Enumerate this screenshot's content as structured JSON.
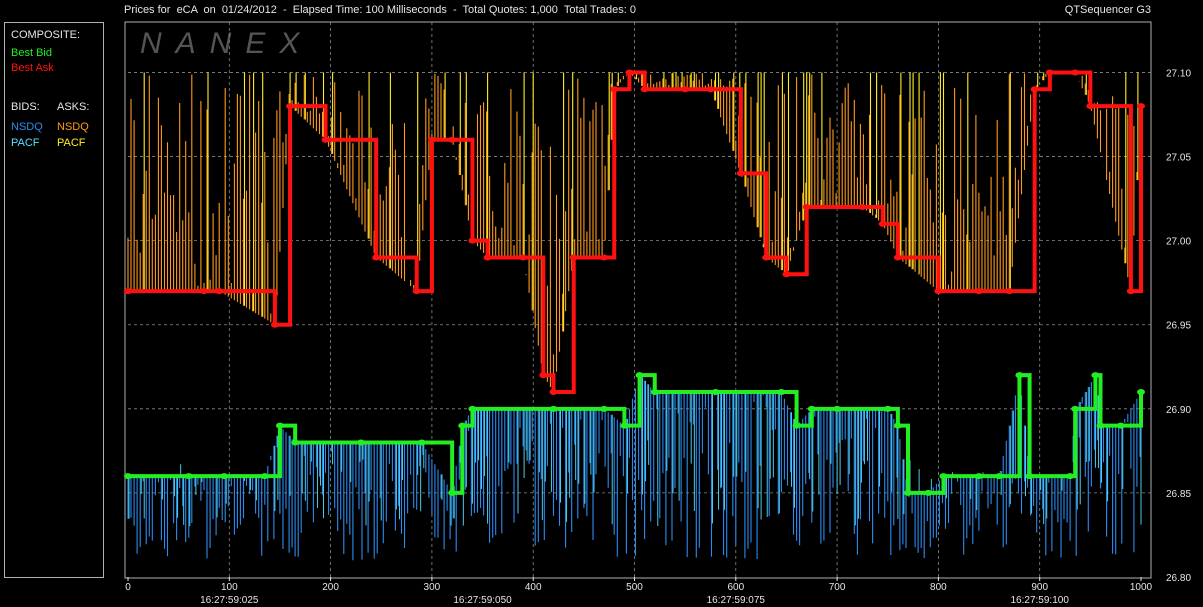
{
  "header": {
    "title": "Prices for  eCA  on  01/24/2012  -  Elapsed Time: 100 Milliseconds  -  Total Quotes: 1,000  Total Trades: 0",
    "app_name": "QTSequencer G3"
  },
  "watermark": "NANEX",
  "legend": {
    "composite_label": "COMPOSITE:",
    "best_bid": "Best Bid",
    "best_ask": "Best Ask",
    "bids_label": "BIDS:",
    "asks_label": "ASKS:",
    "bid_nsdq": "NSDQ",
    "bid_pacf": "PACF",
    "ask_nsdq": "NSDQ",
    "ask_pacf": "PACF"
  },
  "colors": {
    "best_bid": "#22ee22",
    "best_ask": "#ff1111",
    "bid_nsdq": "#2a8cf0",
    "bid_pacf": "#55e0ff",
    "ask_nsdq": "#ff9a1a",
    "ask_pacf": "#ffee22",
    "grid": "#8a8a8a",
    "axis_text": "#e6e6e6"
  },
  "chart_data": {
    "type": "line",
    "xlim": [
      0,
      1000
    ],
    "ylim": [
      26.8,
      27.13
    ],
    "x_ticks": [
      "0",
      "100",
      "200",
      "300",
      "400",
      "500",
      "600",
      "700",
      "800",
      "900",
      "1000"
    ],
    "y_ticks": [
      "26.80",
      "26.85",
      "26.90",
      "26.95",
      "27.00",
      "27.05",
      "27.10"
    ],
    "time_labels": [
      {
        "x": 100,
        "label": "16:27:59:025"
      },
      {
        "x": 350,
        "label": "16:27:59:050"
      },
      {
        "x": 600,
        "label": "16:27:59:075"
      },
      {
        "x": 900,
        "label": "16:27:59:100"
      }
    ],
    "grid": true,
    "series": [
      {
        "name": "Best Ask",
        "key": "best_ask",
        "values": [
          [
            0,
            26.97
          ],
          [
            75,
            26.97
          ],
          [
            90,
            26.97
          ],
          [
            145,
            26.95
          ],
          [
            160,
            27.08
          ],
          [
            195,
            27.06
          ],
          [
            245,
            26.99
          ],
          [
            285,
            26.97
          ],
          [
            300,
            27.06
          ],
          [
            320,
            27.06
          ],
          [
            340,
            27.0
          ],
          [
            355,
            26.99
          ],
          [
            390,
            26.99
          ],
          [
            410,
            26.92
          ],
          [
            420,
            26.91
          ],
          [
            440,
            26.99
          ],
          [
            470,
            26.99
          ],
          [
            480,
            27.09
          ],
          [
            495,
            27.1
          ],
          [
            510,
            27.09
          ],
          [
            550,
            27.09
          ],
          [
            575,
            27.09
          ],
          [
            605,
            27.04
          ],
          [
            630,
            26.99
          ],
          [
            650,
            26.98
          ],
          [
            670,
            27.02
          ],
          [
            725,
            27.02
          ],
          [
            745,
            27.01
          ],
          [
            760,
            26.99
          ],
          [
            800,
            26.97
          ],
          [
            840,
            26.97
          ],
          [
            870,
            26.97
          ],
          [
            895,
            27.09
          ],
          [
            910,
            27.1
          ],
          [
            935,
            27.1
          ],
          [
            950,
            27.08
          ],
          [
            990,
            26.97
          ],
          [
            1000,
            27.08
          ]
        ]
      },
      {
        "name": "Best Bid",
        "key": "best_bid",
        "values": [
          [
            0,
            26.86
          ],
          [
            60,
            26.86
          ],
          [
            95,
            26.86
          ],
          [
            135,
            26.86
          ],
          [
            150,
            26.89
          ],
          [
            165,
            26.88
          ],
          [
            230,
            26.88
          ],
          [
            290,
            26.88
          ],
          [
            320,
            26.85
          ],
          [
            330,
            26.89
          ],
          [
            340,
            26.9
          ],
          [
            420,
            26.9
          ],
          [
            470,
            26.9
          ],
          [
            490,
            26.89
          ],
          [
            505,
            26.92
          ],
          [
            520,
            26.91
          ],
          [
            580,
            26.91
          ],
          [
            645,
            26.91
          ],
          [
            660,
            26.89
          ],
          [
            675,
            26.9
          ],
          [
            700,
            26.9
          ],
          [
            750,
            26.9
          ],
          [
            760,
            26.89
          ],
          [
            770,
            26.85
          ],
          [
            790,
            26.85
          ],
          [
            805,
            26.86
          ],
          [
            840,
            26.86
          ],
          [
            860,
            26.86
          ],
          [
            880,
            26.92
          ],
          [
            890,
            26.86
          ],
          [
            930,
            26.86
          ],
          [
            935,
            26.9
          ],
          [
            955,
            26.92
          ],
          [
            960,
            26.89
          ],
          [
            980,
            26.89
          ],
          [
            1000,
            26.91
          ]
        ]
      }
    ]
  }
}
